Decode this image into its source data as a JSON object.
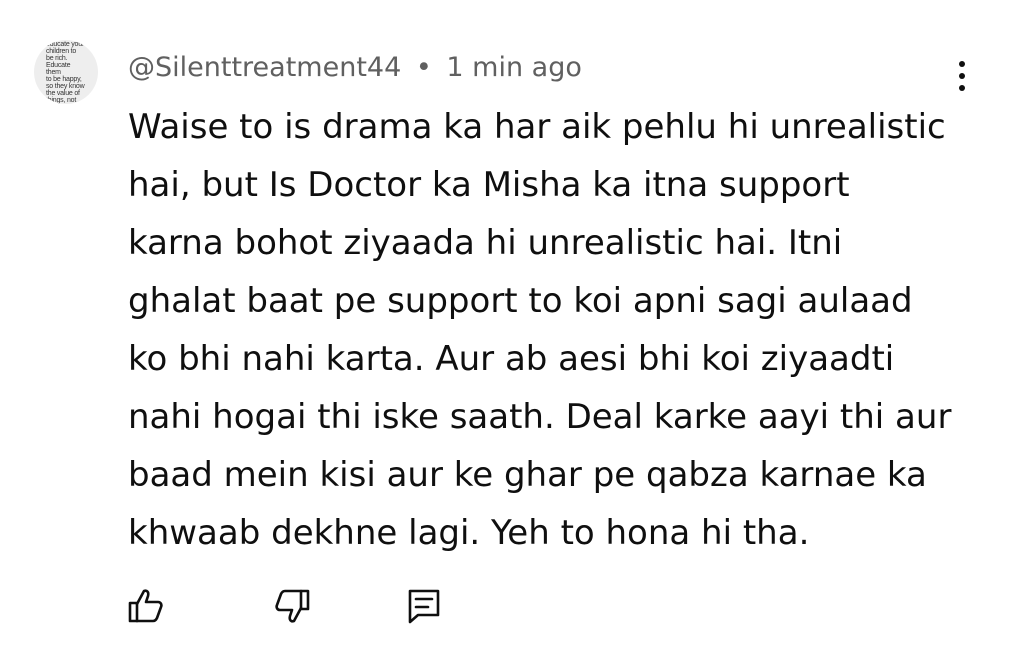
{
  "comment": {
    "avatar_text": "don't\neducate your\nchildren to\nbe rich.\nEducate them\nto be happy,\nso they know\nthe value of\nthings, not\nthe price",
    "author": "@Silenttreatment44",
    "separator": "•",
    "timestamp": "1 min ago",
    "lines": [
      "Waise to is drama ka har aik pehlu hi unrealistic",
      "hai, but Is Doctor ka Misha ka itna support",
      "karna bohot ziyaada hi unrealistic hai. Itni",
      "ghalat baat pe support to koi apni sagi aulaad",
      "ko bhi nahi karta. Aur ab aesi bhi koi ziyaadti",
      "nahi hogai thi iske saath. Deal karke aayi thi aur",
      "baad mein kisi aur ke ghar pe qabza karnae ka",
      "khwaab dekhne lagi. Yeh to hona hi tha."
    ]
  },
  "actions": {
    "like_icon": "thumbs-up-icon",
    "dislike_icon": "thumbs-down-icon",
    "reply_icon": "reply-comment-icon"
  },
  "menu_icon": "more-vertical-icon",
  "colors": {
    "text": "#0f0f0f",
    "meta": "#606060",
    "background": "#ffffff"
  }
}
